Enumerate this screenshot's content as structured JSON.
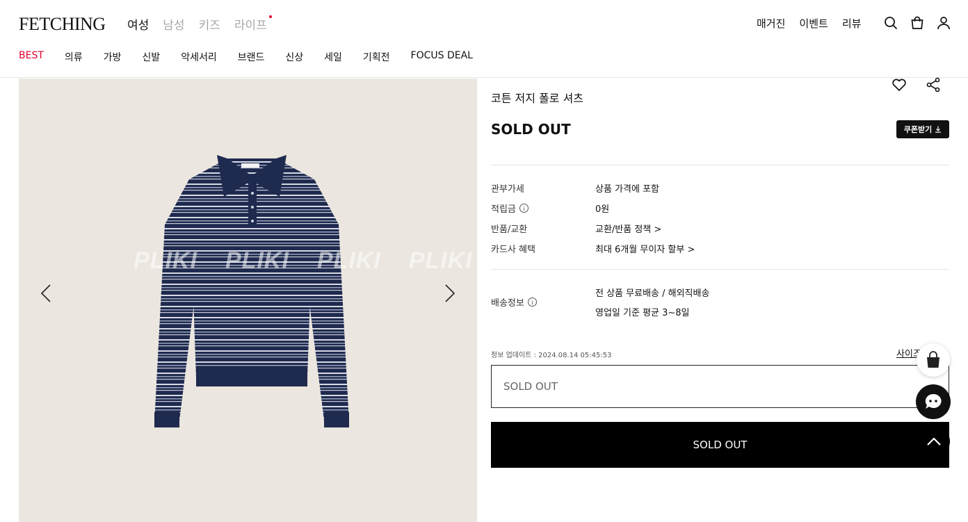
{
  "brand": {
    "logo": "FETCHING"
  },
  "gender_nav": [
    {
      "label": "여성",
      "active": true
    },
    {
      "label": "남성",
      "active": false
    },
    {
      "label": "키즈",
      "active": false
    },
    {
      "label": "라이프",
      "active": false
    }
  ],
  "util_nav": {
    "magazine": "매거진",
    "event": "이벤트",
    "review": "리뷰"
  },
  "header_icons": [
    "search-icon",
    "shopping-bag-icon",
    "user-icon"
  ],
  "category_nav": {
    "best": "BEST",
    "clothing": "의류",
    "bags": "가방",
    "shoes": "신발",
    "accessories": "악세서리",
    "brands": "브랜드",
    "new": "신상",
    "sale": "세일",
    "exhibition": "기획전",
    "focus_deal": "FOCUS DEAL"
  },
  "image": {
    "watermark": [
      "PLIKI",
      "PLIKI",
      "PLIKI",
      "PLIKI"
    ]
  },
  "product": {
    "name": "코튼 저지 폴로 셔츠",
    "status": "SOLD OUT",
    "coupon_label": "쿠폰받기"
  },
  "info": {
    "duty": {
      "label": "관부가세",
      "value": "상품 가격에 포함"
    },
    "points": {
      "label": "적립금",
      "value": "0원"
    },
    "returns": {
      "label": "반품/교환",
      "value": "교환/반품 정책 >"
    },
    "card": {
      "label": "카드사 혜택",
      "value": "최대 6개월 무이자 할부 >"
    },
    "shipping": {
      "label": "배송정보",
      "value1": "전 상품 무료배송 / 해외직배송",
      "value2": "영업일 기준 평균 3~8일"
    }
  },
  "update": {
    "text": "정보 업데이트 : 2024.08.14 05:45:53",
    "size_link": "사이즈"
  },
  "option_select": {
    "value": "SOLD OUT"
  },
  "buy_button": {
    "label": "SOLD OUT"
  },
  "colors": {
    "accent_red": "#e0002a",
    "image_bg": "#ebe6df",
    "shirt_navy": "#1f2a4f"
  }
}
